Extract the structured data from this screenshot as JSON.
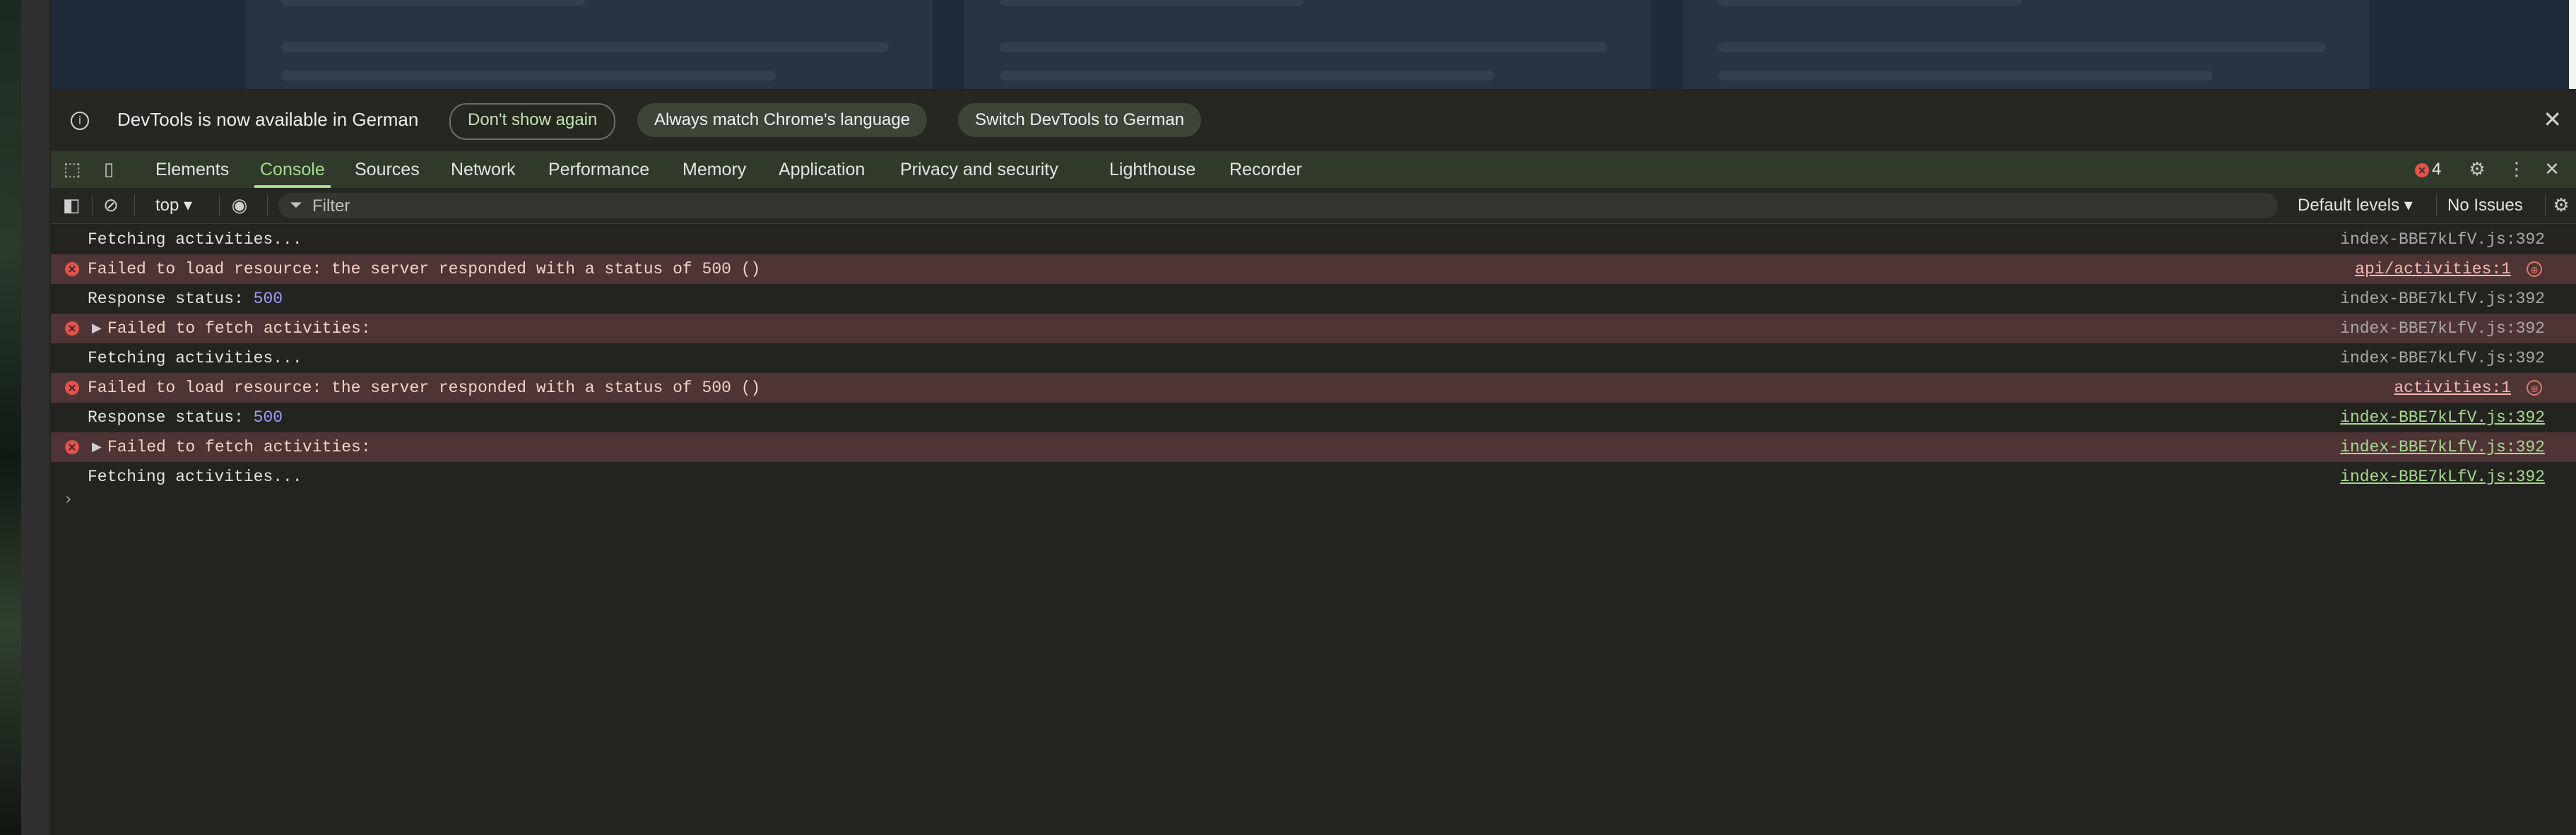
{
  "infobar": {
    "message": "DevTools is now available in German",
    "dont_show": "Don't show again",
    "always_match": "Always match Chrome's language",
    "switch_german": "Switch DevTools to German",
    "close_icon": "close-icon",
    "info_icon": "info-icon"
  },
  "tabs": [
    "Elements",
    "Console",
    "Sources",
    "Network",
    "Performance",
    "Memory",
    "Application",
    "Privacy and security",
    "Lighthouse",
    "Recorder"
  ],
  "active_tab": "Console",
  "error_count": "4",
  "toolbar": {
    "context": "top",
    "filter_placeholder": "Filter",
    "levels": "Default levels",
    "issues": "No Issues"
  },
  "console": {
    "messages": [
      {
        "type": "log",
        "text": "Fetching activities...",
        "source": "index-BBE7kLfV.js:392"
      },
      {
        "type": "error",
        "text": "Failed to load resource: the server responded with a status of 500 ()",
        "source": "api/activities:1"
      },
      {
        "type": "log",
        "text": "Response status: ",
        "value": "500",
        "source": "index-BBE7kLfV.js:392"
      },
      {
        "type": "error",
        "text": "Failed to fetch activities:",
        "source": "index-BBE7kLfV.js:392"
      },
      {
        "type": "log",
        "text": "Fetching activities...",
        "source": "index-BBE7kLfV.js:392"
      },
      {
        "type": "error",
        "text": "Failed to load resource: the server responded with a status of 500 ()",
        "source": "activities:1"
      },
      {
        "type": "log",
        "text": "Response status: ",
        "value": "500",
        "source": "index-BBE7kLfV.js:392"
      },
      {
        "type": "error",
        "text": "Failed to fetch activities:",
        "source": "index-BBE7kLfV.js:392"
      },
      {
        "type": "log",
        "text": "Fetching activities...",
        "source": "index-BBE7kLfV.js:392"
      }
    ],
    "prompt": "›"
  },
  "colors": {
    "accent": "#a7d890",
    "error_bg": "#4e3434",
    "error_icon": "#e3534b",
    "number": "#9f9dff"
  }
}
